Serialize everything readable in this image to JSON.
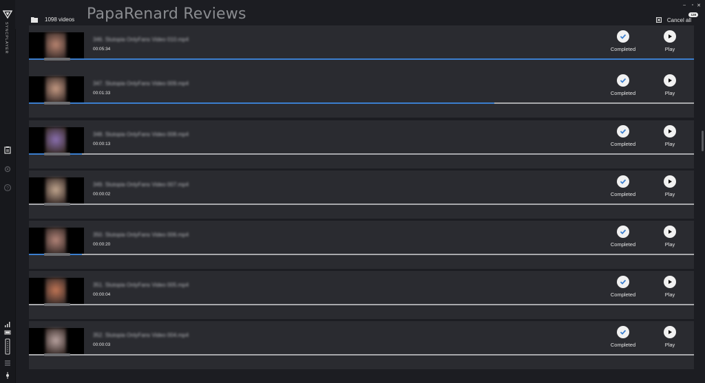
{
  "app": {
    "brand": "SYNCPLAYER",
    "count_label": "1098 videos",
    "watermark": "PapaRenard Reviews",
    "cancel_all": "Cancel all",
    "badge": "128"
  },
  "colors": {
    "accent": "#3b7fd0",
    "bg": "#1c1d22",
    "row": "#2a2b30"
  },
  "items": [
    {
      "title": "346. Slutopia OnlyFans Video 010.mp4",
      "duration": "00:05:34",
      "status": "Completed",
      "play": "Play",
      "thumb": "#b98470",
      "progress": 1.0
    },
    {
      "title": "347. Slutopia OnlyFans Video 009.mp4",
      "duration": "00:01:33",
      "status": "Completed",
      "play": "Play",
      "thumb": "#c59a83",
      "progress": 0.7
    },
    {
      "title": "348. Slutopia OnlyFans Video 008.mp4",
      "duration": "00:00:13",
      "status": "Completed",
      "play": "Play",
      "thumb": "#8a6fb0",
      "progress": 0.08
    },
    {
      "title": "349. Slutopia OnlyFans Video 007.mp4",
      "duration": "00:00:02",
      "status": "Completed",
      "play": "Play",
      "thumb": "#c1a68e",
      "progress": 0.0
    },
    {
      "title": "350. Slutopia OnlyFans Video 006.mp4",
      "duration": "00:00:20",
      "status": "Completed",
      "play": "Play",
      "thumb": "#b38478",
      "progress": 0.08
    },
    {
      "title": "351. Slutopia OnlyFans Video 005.mp4",
      "duration": "00:00:04",
      "status": "Completed",
      "play": "Play",
      "thumb": "#c17555",
      "progress": 0.0
    },
    {
      "title": "352. Slutopia OnlyFans Video 004.mp4",
      "duration": "00:00:03",
      "status": "Completed",
      "play": "Play",
      "thumb": "#b9a3a0",
      "progress": 0.0
    }
  ]
}
